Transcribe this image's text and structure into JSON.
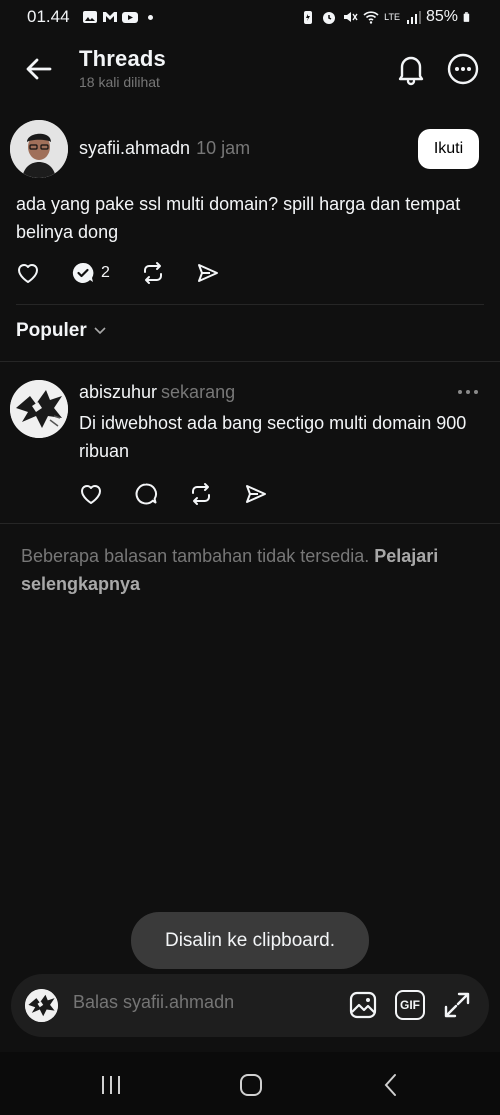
{
  "status_bar": {
    "time": "01.44",
    "battery": "85%",
    "network_label": "LTE"
  },
  "header": {
    "title": "Threads",
    "subtitle": "18 kali dilihat"
  },
  "post": {
    "username": "syafii.ahmadn",
    "time": "10 jam",
    "follow_label": "Ikuti",
    "text": "ada yang pake ssl multi domain? spill harga dan tempat belinya dong",
    "reply_count": "2"
  },
  "sort": {
    "label": "Populer"
  },
  "reply": {
    "username": "abiszuhur",
    "time": "sekarang",
    "text": "Di idwebhost ada bang sectigo multi domain 900 ribuan"
  },
  "note": {
    "text": "Beberapa balasan tambahan tidak tersedia. ",
    "learn_more": "Pelajari selengkapnya"
  },
  "toast": {
    "text": "Disalin ke clipboard."
  },
  "composer": {
    "placeholder": "Balas syafii.ahmadn",
    "gif_label": "GIF"
  },
  "colors": {
    "background": "#101010",
    "text_primary": "#f3f5f7",
    "text_secondary": "#777777",
    "divider": "#262626",
    "toast_bg": "#3a3a3a"
  }
}
